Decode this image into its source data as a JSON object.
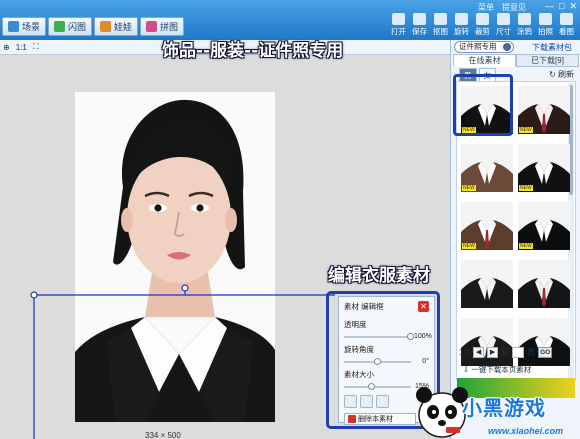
{
  "header": {
    "menu": [
      "菜单",
      "提意见"
    ],
    "window_controls": [
      "—",
      "□",
      "✕"
    ],
    "mode_tabs": [
      {
        "label": "场景",
        "icon": "scene-icon",
        "color": "#3a8bd6"
      },
      {
        "label": "闪图",
        "icon": "flash-icon",
        "color": "#3fae4f"
      },
      {
        "label": "娃娃",
        "icon": "doll-icon",
        "color": "#e08a2a"
      },
      {
        "label": "拼图",
        "icon": "puzzle-icon",
        "color": "#d04d8a"
      }
    ],
    "tools": [
      {
        "label": "打开",
        "icon": "open-icon"
      },
      {
        "label": "保存",
        "icon": "save-icon"
      },
      {
        "label": "抠图",
        "icon": "cutout-icon"
      },
      {
        "label": "旋转",
        "icon": "rotate-icon"
      },
      {
        "label": "裁剪",
        "icon": "crop-icon"
      },
      {
        "label": "尺寸",
        "icon": "resize-icon"
      },
      {
        "label": "涂鸦",
        "icon": "brush-icon"
      },
      {
        "label": "拍照",
        "icon": "camera-icon"
      },
      {
        "label": "看图",
        "icon": "view-icon"
      }
    ]
  },
  "zoom": {
    "fit": "1:1"
  },
  "canvas": {
    "size_label": "334 × 500"
  },
  "annotations": {
    "banner_top": "饰品--服装--证件照专用",
    "banner_edit": "编辑衣服素材"
  },
  "edit_panel": {
    "title": "素材 编辑框",
    "opacity_label": "透明度",
    "opacity_value": "100%",
    "opacity_fraction": 1.0,
    "rotation_label": "旋转角度",
    "rotation_value": "0°",
    "rotation_fraction": 0.5,
    "size_label": "素材大小",
    "size_value": "15%",
    "size_fraction": 0.42,
    "delete_label": "删除本素材"
  },
  "right_panel": {
    "category": "证件照专用",
    "download_link": "下载素材包",
    "tabs": [
      "在线素材",
      "已下载[9]"
    ],
    "gender_tabs": [
      "男",
      "女"
    ],
    "refresh": "刷新",
    "new_badge": "NEW",
    "pager": {
      "current": "1/3",
      "go_to": "到",
      "page": "页",
      "go": "GO"
    },
    "download_page": "一键下载本页素材"
  },
  "watermark": {
    "brand": "小黑游戏",
    "url": "www.xiaohei.com"
  },
  "colors": {
    "title_bar": "#1f78c8",
    "highlight": "#1e3fae",
    "close_red": "#d9302a"
  }
}
